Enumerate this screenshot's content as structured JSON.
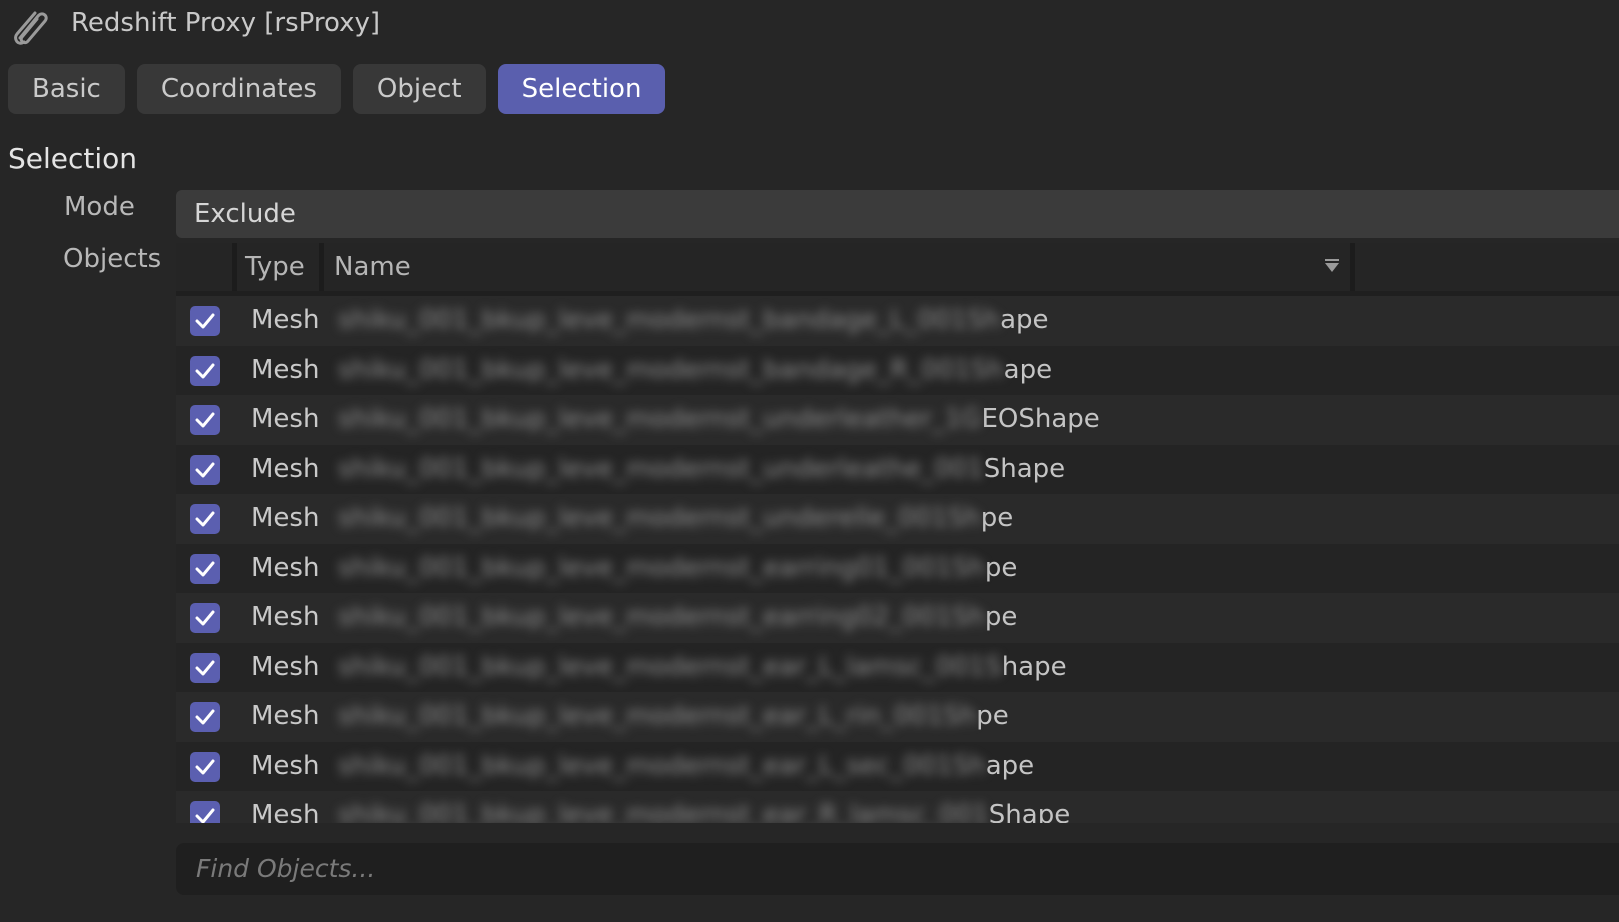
{
  "window": {
    "title": "Redshift Proxy [rsProxy]",
    "icon": "paperclip-icon"
  },
  "tabs": [
    {
      "label": "Basic",
      "active": false
    },
    {
      "label": "Coordinates",
      "active": false
    },
    {
      "label": "Object",
      "active": false
    },
    {
      "label": "Selection",
      "active": true
    }
  ],
  "section": {
    "title": "Selection",
    "mode_label": "Mode",
    "mode_value": "Exclude",
    "objects_label": "Objects"
  },
  "table": {
    "columns": [
      "Type",
      "Name"
    ],
    "sort_icon": "sort-down-icon",
    "rows": [
      {
        "checked": true,
        "type": "Mesh",
        "name_hidden": "shiku_001_bkup_leve_modernst_bandage_L_001Sh",
        "name_visible": "ape"
      },
      {
        "checked": true,
        "type": "Mesh",
        "name_hidden": "shiku_001_bkup_leve_modernst_bandage_R_001Sh",
        "name_visible": "ape"
      },
      {
        "checked": true,
        "type": "Mesh",
        "name_hidden": "shiku_001_bkup_leve_modernst_underleather_1G",
        "name_visible": "EOShape"
      },
      {
        "checked": true,
        "type": "Mesh",
        "name_hidden": "shiku_001_bkup_leve_modernst_underleathe_001",
        "name_visible": "Shape"
      },
      {
        "checked": true,
        "type": "Mesh",
        "name_hidden": "shiku_001_bkup_leve_modernst_underelle_001Sh",
        "name_visible": "pe"
      },
      {
        "checked": true,
        "type": "Mesh",
        "name_hidden": "shiku_001_bkup_leve_modernst_earring01_001Sh",
        "name_visible": "pe"
      },
      {
        "checked": true,
        "type": "Mesh",
        "name_hidden": "shiku_001_bkup_leve_modernst_earring02_001Sh",
        "name_visible": "pe"
      },
      {
        "checked": true,
        "type": "Mesh",
        "name_hidden": "shiku_001_bkup_leve_modernst_ear_L_lamsc_001S",
        "name_visible": "hape"
      },
      {
        "checked": true,
        "type": "Mesh",
        "name_hidden": "shiku_001_bkup_leve_modernst_ear_L_rin_001Sh",
        "name_visible": "pe"
      },
      {
        "checked": true,
        "type": "Mesh",
        "name_hidden": "shiku_001_bkup_leve_modernst_ear_L_sec_001Sh",
        "name_visible": "ape"
      },
      {
        "checked": true,
        "type": "Mesh",
        "name_hidden": "shiku_001_bkup_leve_modernst_ear_R_lamsc_001",
        "name_visible": "Shape"
      }
    ]
  },
  "search": {
    "placeholder": "Find Objects..."
  },
  "colors": {
    "accent": "#5a5fae",
    "background": "#262626",
    "tab_inactive": "#383838"
  }
}
